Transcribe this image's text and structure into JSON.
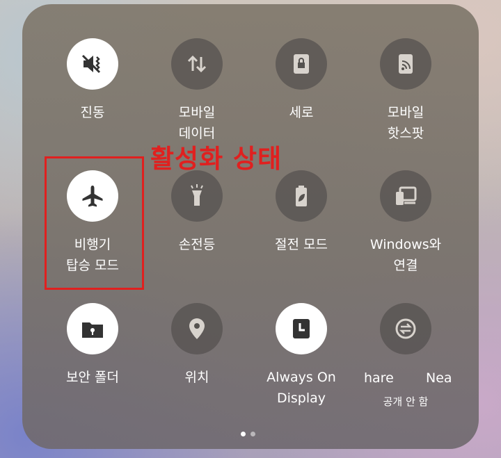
{
  "tiles": [
    {
      "label": "진동",
      "icon": "vibrate-mute-icon",
      "active": true
    },
    {
      "label": "모바일\n데이터",
      "icon": "mobile-data-icon",
      "active": false
    },
    {
      "label": "세로",
      "icon": "portrait-lock-icon",
      "active": false
    },
    {
      "label": "모바일\n핫스팟",
      "icon": "hotspot-icon",
      "active": false
    },
    {
      "label": "비행기\n탑승 모드",
      "icon": "airplane-icon",
      "active": true
    },
    {
      "label": "손전등",
      "icon": "flashlight-icon",
      "active": false
    },
    {
      "label": "절전 모드",
      "icon": "battery-saver-icon",
      "active": false
    },
    {
      "label": "Windows와\n연결",
      "icon": "link-to-windows-icon",
      "active": false
    },
    {
      "label": "보안 폴더",
      "icon": "secure-folder-icon",
      "active": true
    },
    {
      "label": "위치",
      "icon": "location-icon",
      "active": false
    },
    {
      "label": "Always On\nDisplay",
      "icon": "clock-icon",
      "active": true
    },
    {
      "label": "",
      "icon": "quick-share-icon",
      "active": false
    }
  ],
  "quick_share": {
    "left_text": "hare",
    "right_text": "Nea",
    "sublabel": "공개 안 함"
  },
  "annotation": {
    "text": "활성화 상태",
    "color": "#e0201f"
  },
  "pagination": {
    "pages": 2,
    "current": 1
  }
}
